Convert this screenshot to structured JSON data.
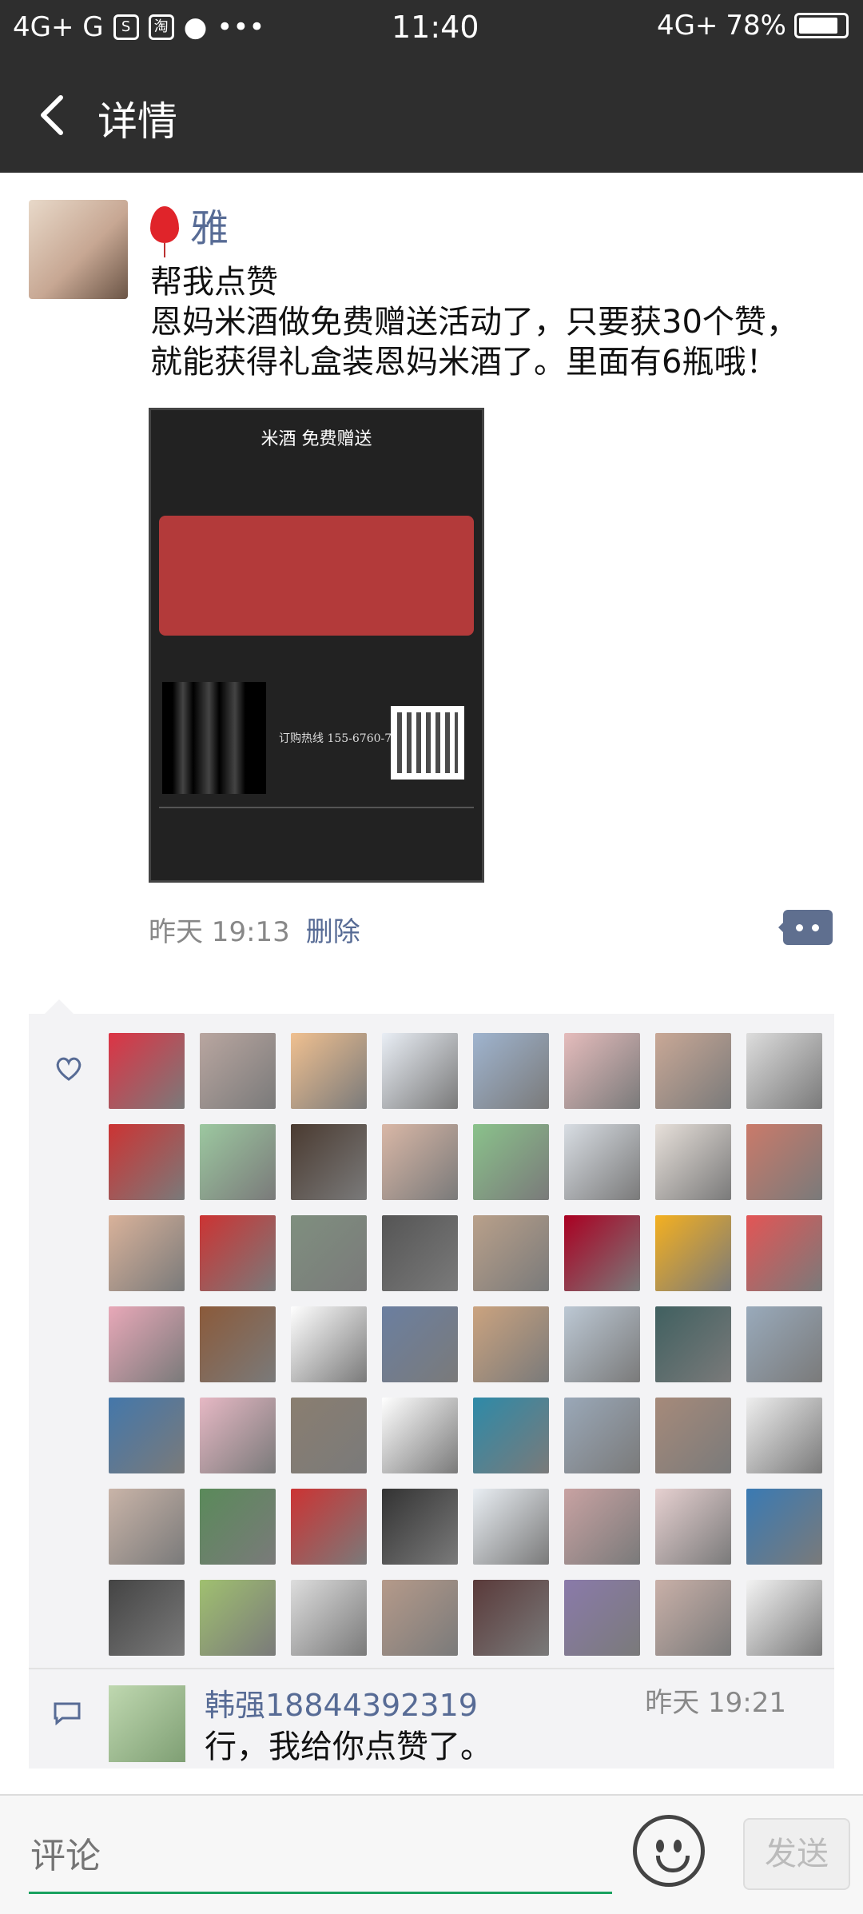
{
  "status_bar": {
    "left_text": "4G+ G",
    "icons": [
      "signal-icon",
      "signal-icon",
      "s-app-icon",
      "taobao-icon",
      "message-icon",
      "more-dots-icon"
    ],
    "time": "11:40",
    "network": "4G+",
    "battery": "78%"
  },
  "titlebar": {
    "back_icon": "back-arrow-icon",
    "title": "详情"
  },
  "post": {
    "username": "雅",
    "user_icon": "balloon-icon",
    "text_lines": [
      "帮我点赞",
      "恩妈米酒做免费赠送活动了，只要获30个赞，",
      "就能获得礼盒装恩妈米酒了。里面有6瓶哦！"
    ],
    "poster": {
      "title": "米酒 免费赠送",
      "phone": "订购热线 155-6760-7076"
    },
    "time": "昨天 19:13",
    "delete_label": "删除",
    "more_icon": "comment-more-icon"
  },
  "likes": {
    "heart_icon": "heart-icon",
    "avatar_colors": [
      "#d34",
      "#b9a6a0",
      "#f0c090",
      "#e9eef5",
      "#9fb4cf",
      "#e5bcbc",
      "#c9a896",
      "#ddd",
      "#c33",
      "#9cc8a0",
      "#4a3a30",
      "#d9b7a6",
      "#8ac28b",
      "#d8dde3",
      "#e7e0da",
      "#ca7a6a",
      "#d9b29a",
      "#c33",
      "#7f8f7f",
      "#555",
      "#b9a08a",
      "#a02",
      "#f4b020",
      "#e35555",
      "#e8a8b8",
      "#8b5a3a",
      "#fff",
      "#6b7fa0",
      "#cba37f",
      "#bcc8d4",
      "#406060",
      "#9ab",
      "#4477aa",
      "#e6b8c4",
      "#8a7e70",
      "#fff",
      "#2e8aa8",
      "#9aa8b8",
      "#a68a7a",
      "#eee",
      "#c9b4a8",
      "#5a8a5a",
      "#c33",
      "#333",
      "#e9eef3",
      "#c8a2a2",
      "#e6d0d0",
      "#3a7ab3",
      "#444",
      "#a0c070",
      "#ddd",
      "#b59a8a",
      "#5a3a3a",
      "#8a7aaa",
      "#c9b0a8",
      "#f3f3f3"
    ]
  },
  "comment": {
    "author": "韩强18844392319",
    "time": "昨天 19:21",
    "content": "行，我给你点赞了。",
    "icon": "comment-icon"
  },
  "input_bar": {
    "placeholder": "评论",
    "emoji_icon": "emoji-icon",
    "send_label": "发送"
  }
}
